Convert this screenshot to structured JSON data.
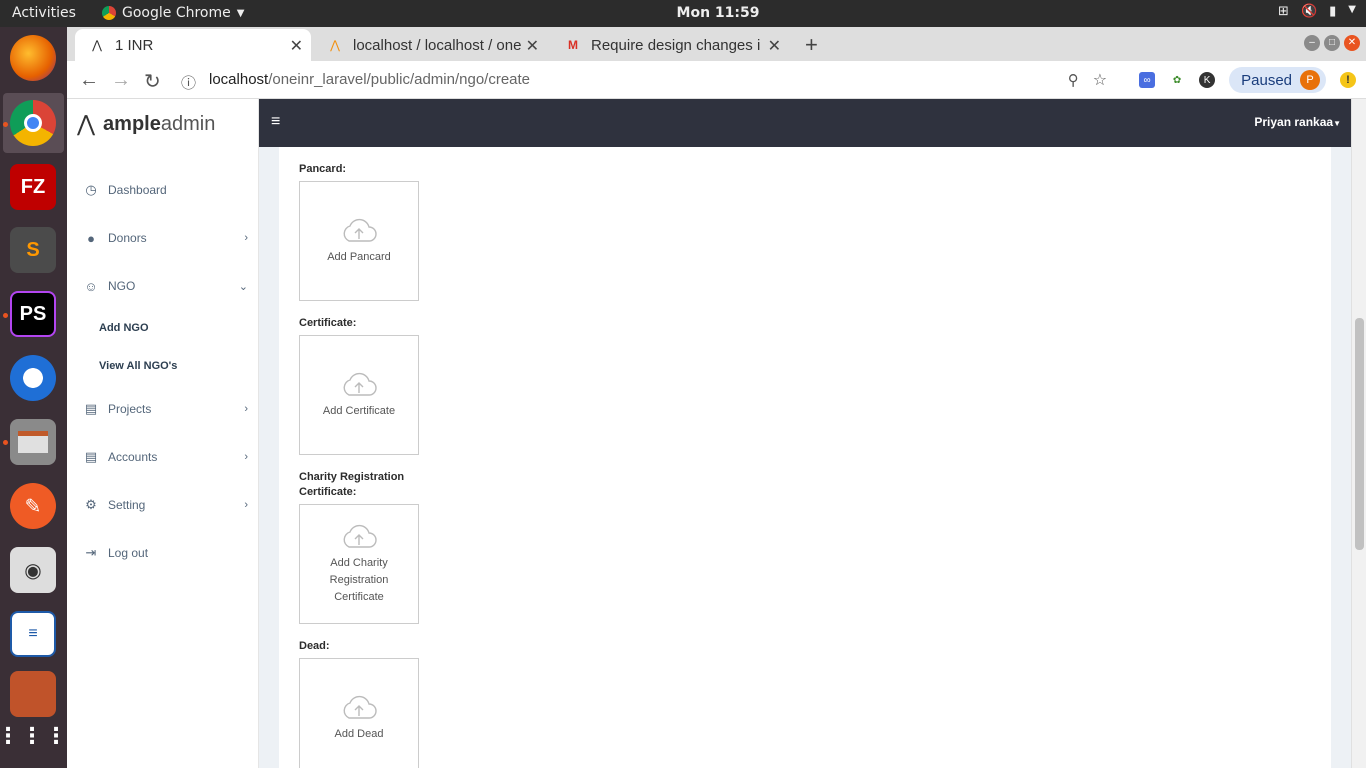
{
  "os": {
    "activities": "Activities",
    "app_name": "Google Chrome",
    "clock": "Mon 11:59"
  },
  "browser": {
    "tabs": [
      {
        "label": "1 INR"
      },
      {
        "label": "localhost / localhost / one"
      },
      {
        "label": "Require design changes i"
      }
    ],
    "url_host": "localhost",
    "url_path": "/oneinr_laravel/public/admin/ngo/create",
    "profile_status": "Paused",
    "profile_initial": "P"
  },
  "app": {
    "brand_bold": "ample",
    "brand_light": "admin",
    "user_name": "Priyan rankaa",
    "sidebar": {
      "items": [
        {
          "label": "Dashboard",
          "icon": "dashboard-icon"
        },
        {
          "label": "Donors",
          "icon": "user-icon"
        },
        {
          "label": "NGO",
          "icon": "smile-icon"
        },
        {
          "label": "Projects",
          "icon": "projects-icon"
        },
        {
          "label": "Accounts",
          "icon": "accounts-icon"
        },
        {
          "label": "Setting",
          "icon": "gear-icon"
        },
        {
          "label": "Log out",
          "icon": "logout-icon"
        }
      ],
      "ngo_sub": [
        {
          "label": "Add NGO"
        },
        {
          "label": "View All NGO's"
        }
      ]
    },
    "form": {
      "fields": [
        {
          "label": "Pancard:",
          "upload_text": "Add Pancard"
        },
        {
          "label": "Certificate:",
          "upload_text": "Add Certificate"
        },
        {
          "label": "Charity Registration Certificate:",
          "upload_text": "Add Charity Registration Certificate"
        },
        {
          "label": "Dead:",
          "upload_text": "Add Dead"
        }
      ]
    }
  },
  "colors": {
    "header_bg": "#2f323e",
    "page_bg": "#edf1f5",
    "accent": "#e95420"
  }
}
